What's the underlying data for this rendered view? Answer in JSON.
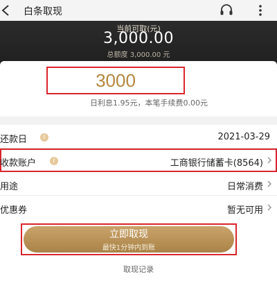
{
  "header": {
    "title": "白条取现"
  },
  "hero": {
    "available_label": "当前可取(元)",
    "available_amount": "3,000.00",
    "total_quota": "总额度 3,000.00 元"
  },
  "amount": {
    "value": "3000",
    "interest_note": "日利息1.95元，本笔手续费0.00元"
  },
  "rows": {
    "repay_date": {
      "label": "还款日",
      "value": "2021-03-29"
    },
    "account": {
      "label": "收款账户",
      "value": "工商银行储蓄卡(8564)"
    },
    "purpose": {
      "label": "用途",
      "value": "日常消费"
    },
    "coupon": {
      "label": "优惠券",
      "value": "暂无可用"
    }
  },
  "action": {
    "button_label": "立即取现",
    "button_sub": "最快1分钟内到账",
    "record_link": "取现记录"
  },
  "colors": {
    "accent_gold": "#b4873f",
    "highlight_red": "#d9252b",
    "hero_bg": "#252525"
  },
  "icons": [
    "back-arrow-icon",
    "headset-icon",
    "more-icon",
    "info-icon",
    "chevron-right-icon"
  ]
}
